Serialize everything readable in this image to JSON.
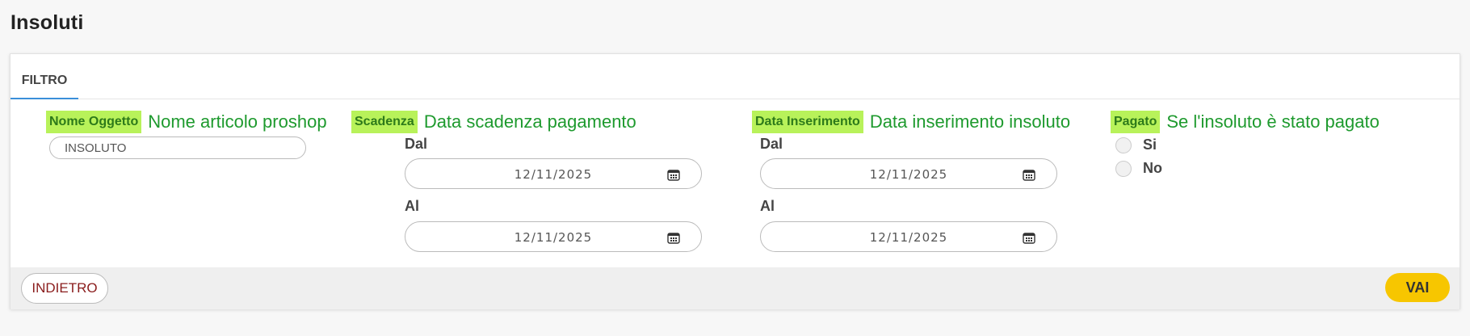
{
  "page": {
    "title": "Insoluti"
  },
  "tabs": [
    {
      "label": "FILTRO",
      "active": true
    }
  ],
  "filters": {
    "nome_oggetto": {
      "label": "Nome Oggetto",
      "description": "Nome articolo proshop",
      "value": "INSOLUTO"
    },
    "scadenza": {
      "label": "Scadenza",
      "description": "Data scadenza pagamento",
      "from_label": "Dal",
      "from_value": "12/11/2025",
      "to_label": "Al",
      "to_value": "12/11/2025"
    },
    "data_inserimento": {
      "label": "Data Inserimento",
      "description": "Data inserimento insoluto",
      "from_label": "Dal",
      "from_value": "12/11/2025",
      "to_label": "Al",
      "to_value": "12/11/2025"
    },
    "pagato": {
      "label": "Pagato",
      "description": "Se l'insoluto è stato pagato",
      "options": [
        {
          "label": "Si",
          "selected": false
        },
        {
          "label": "No",
          "selected": false
        }
      ]
    }
  },
  "footer": {
    "back_label": "INDIETRO",
    "go_label": "VAI"
  },
  "colors": {
    "label_highlight": "#b8f25a",
    "description_text": "#1e9a2e",
    "back_text": "#8a1c1c",
    "go_button": "#f7c600",
    "tab_underline": "#3a8fd9"
  },
  "icons": {
    "date_picker": "calendar-icon"
  }
}
